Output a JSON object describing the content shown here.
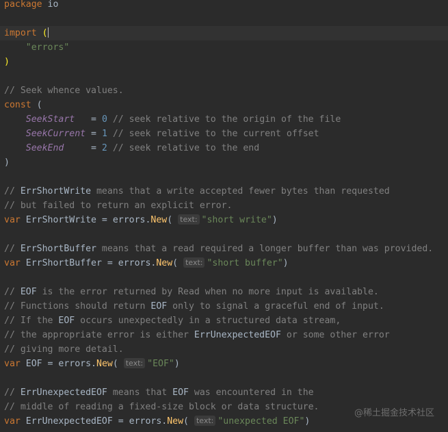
{
  "editor": {
    "lines": [
      [
        {
          "t": "package",
          "c": "kw"
        },
        {
          "t": " io",
          "c": "pkg"
        }
      ],
      [],
      [
        {
          "t": "import",
          "c": "kw"
        },
        {
          "t": " "
        },
        {
          "t": "(",
          "c": "paren-match"
        },
        {
          "caret": true
        }
      ],
      [
        {
          "t": "    "
        },
        {
          "t": "\"errors\"",
          "c": "str"
        }
      ],
      [
        {
          "t": ")",
          "c": "paren-match"
        }
      ],
      [],
      [
        {
          "t": "// Seek whence values.",
          "c": "cm"
        }
      ],
      [
        {
          "t": "const",
          "c": "kw"
        },
        {
          "t": " ("
        }
      ],
      [
        {
          "t": "    "
        },
        {
          "t": "SeekStart",
          "c": "const"
        },
        {
          "t": "   = "
        },
        {
          "t": "0",
          "c": "num"
        },
        {
          "t": " // seek relative to the origin of the file",
          "c": "cm"
        }
      ],
      [
        {
          "t": "    "
        },
        {
          "t": "SeekCurrent",
          "c": "const"
        },
        {
          "t": " = "
        },
        {
          "t": "1",
          "c": "num"
        },
        {
          "t": " // seek relative to the current offset",
          "c": "cm"
        }
      ],
      [
        {
          "t": "    "
        },
        {
          "t": "SeekEnd",
          "c": "const"
        },
        {
          "t": "     = "
        },
        {
          "t": "2",
          "c": "num"
        },
        {
          "t": " // seek relative to the end",
          "c": "cm"
        }
      ],
      [
        {
          "t": ")"
        }
      ],
      [],
      [
        {
          "t": "// ",
          "c": "cm"
        },
        {
          "t": "ErrShortWrite",
          "c": "cm-strong"
        },
        {
          "t": " means that a write accepted fewer bytes than requested",
          "c": "cm"
        }
      ],
      [
        {
          "t": "// but failed to return an explicit error.",
          "c": "cm"
        }
      ],
      [
        {
          "t": "var",
          "c": "kw"
        },
        {
          "t": " ErrShortWrite = "
        },
        {
          "t": "errors",
          "c": "pkg"
        },
        {
          "t": "."
        },
        {
          "t": "New",
          "c": "fn"
        },
        {
          "t": "( "
        },
        {
          "hint": "text:"
        },
        {
          "t": "\"short write\"",
          "c": "str"
        },
        {
          "t": ")"
        }
      ],
      [],
      [
        {
          "t": "// ",
          "c": "cm"
        },
        {
          "t": "ErrShortBuffer",
          "c": "cm-strong"
        },
        {
          "t": " means that a read required a longer buffer than was provided.",
          "c": "cm"
        }
      ],
      [
        {
          "t": "var",
          "c": "kw"
        },
        {
          "t": " ErrShortBuffer = "
        },
        {
          "t": "errors",
          "c": "pkg"
        },
        {
          "t": "."
        },
        {
          "t": "New",
          "c": "fn"
        },
        {
          "t": "( "
        },
        {
          "hint": "text:"
        },
        {
          "t": "\"short buffer\"",
          "c": "str"
        },
        {
          "t": ")"
        }
      ],
      [],
      [
        {
          "t": "// ",
          "c": "cm"
        },
        {
          "t": "EOF",
          "c": "cm-strong"
        },
        {
          "t": " is the error returned by Read when no more input is available.",
          "c": "cm"
        }
      ],
      [
        {
          "t": "// Functions should return ",
          "c": "cm"
        },
        {
          "t": "EOF",
          "c": "cm-strong"
        },
        {
          "t": " only to signal a graceful end of input.",
          "c": "cm"
        }
      ],
      [
        {
          "t": "// If the ",
          "c": "cm"
        },
        {
          "t": "EOF",
          "c": "cm-strong"
        },
        {
          "t": " occurs unexpectedly in a structured data stream,",
          "c": "cm"
        }
      ],
      [
        {
          "t": "// the appropriate error is either ",
          "c": "cm"
        },
        {
          "t": "ErrUnexpectedEOF",
          "c": "cm-strong"
        },
        {
          "t": " or some other error",
          "c": "cm"
        }
      ],
      [
        {
          "t": "// giving more detail.",
          "c": "cm"
        }
      ],
      [
        {
          "t": "var",
          "c": "kw"
        },
        {
          "t": " EOF = "
        },
        {
          "t": "errors",
          "c": "pkg"
        },
        {
          "t": "."
        },
        {
          "t": "New",
          "c": "fn"
        },
        {
          "t": "( "
        },
        {
          "hint": "text:"
        },
        {
          "t": "\"EOF\"",
          "c": "str"
        },
        {
          "t": ")"
        }
      ],
      [],
      [
        {
          "t": "// ",
          "c": "cm"
        },
        {
          "t": "ErrUnexpectedEOF",
          "c": "cm-strong"
        },
        {
          "t": " means that ",
          "c": "cm"
        },
        {
          "t": "EOF",
          "c": "cm-strong"
        },
        {
          "t": " was encountered in the",
          "c": "cm"
        }
      ],
      [
        {
          "t": "// middle of reading a fixed-size block or data structure.",
          "c": "cm"
        }
      ],
      [
        {
          "t": "var",
          "c": "kw"
        },
        {
          "t": " ErrUnexpectedEOF = "
        },
        {
          "t": "errors",
          "c": "pkg"
        },
        {
          "t": "."
        },
        {
          "t": "New",
          "c": "fn"
        },
        {
          "t": "( "
        },
        {
          "hint": "text:"
        },
        {
          "t": "\"unexpected EOF\"",
          "c": "str"
        },
        {
          "t": ")"
        }
      ]
    ]
  },
  "watermark": "@稀土掘金技术社区",
  "colors": {
    "background": "#2b2b2b",
    "current_line": "#323232",
    "keyword": "#cc7832",
    "comment": "#808080",
    "string": "#6a8759",
    "number": "#6897bb",
    "constant": "#9876aa",
    "function": "#ffc66d"
  }
}
